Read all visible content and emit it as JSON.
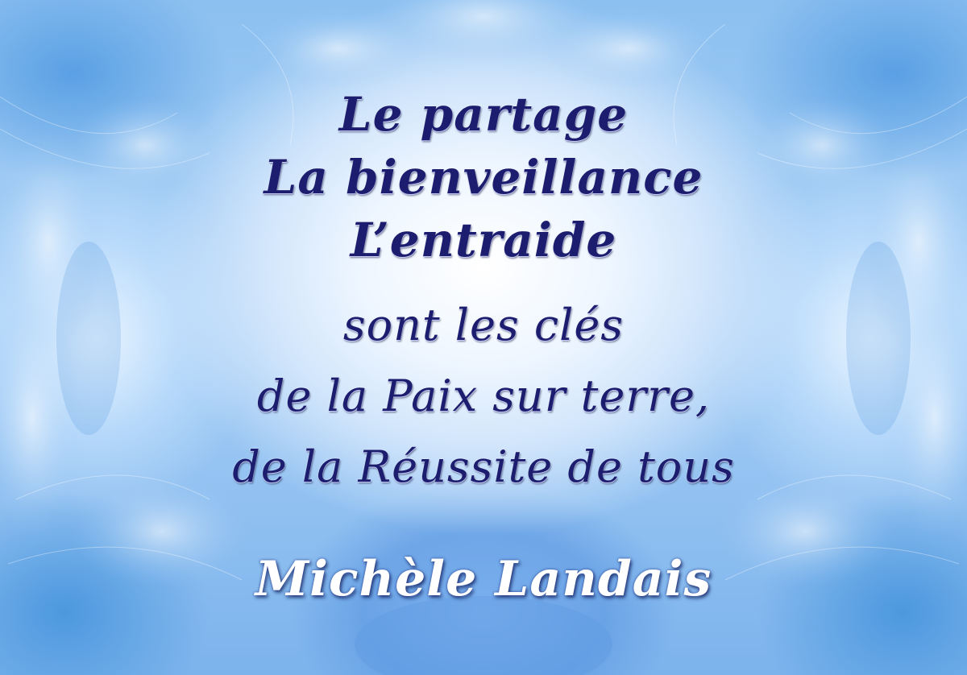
{
  "quote": {
    "lines": [
      "Le partage",
      "La bienveillance",
      "L’entraide",
      "sont les clés",
      "de la Paix sur terre,",
      "de la  Réussite de tous"
    ],
    "author": "Michèle Landais"
  },
  "colors": {
    "quote_text": "#1c1d6e",
    "author_text": "#ffffff",
    "background_center": "#ffffff",
    "background_edge": "#5aa0e4"
  }
}
